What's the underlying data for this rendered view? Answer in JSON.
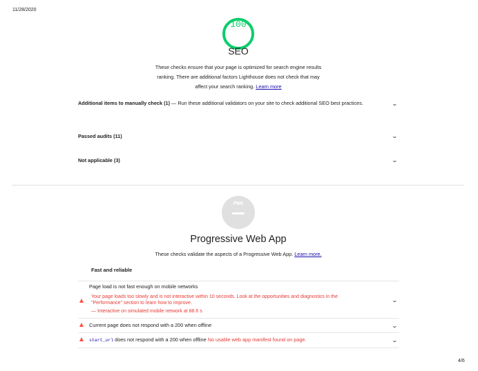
{
  "header": {
    "date": "11/28/2020"
  },
  "seo": {
    "score": "100",
    "title": "SEO",
    "description_lines": [
      "These checks ensure that your page is optimized for search engine results",
      "ranking. There are additional factors Lighthouse does not check that may",
      "affect your search ranking."
    ],
    "learn_more": "Learn more",
    "score_color": "#0cce6b",
    "groups": [
      {
        "label": "Additional items to manually check (1)",
        "detail": " — Run these additional validators on your site to check additional SEO best practices."
      },
      {
        "label": "Passed audits (11)",
        "detail": ""
      },
      {
        "label": "Not applicable (3)",
        "detail": ""
      }
    ]
  },
  "pwa": {
    "badge": "PWA",
    "title": "Progressive Web App",
    "description": "These checks validate the aspects of a Progressive Web App.",
    "learn_more": "Learn more.",
    "section": "Fast and reliable",
    "audits": [
      {
        "title": "Page load is not fast enough on mobile networks",
        "detail_lines": [
          "Your page loads too slowly and is not interactive within 10 seconds. Look at the opportunities and diagnostics in the",
          "\"Performance\" section to learn how to improve."
        ],
        "sub": "— Interactive on simulated mobile network at 88.6 s"
      },
      {
        "title": "Current page does not respond with a 200 when offline"
      },
      {
        "code": "start_url",
        "title": " does not respond with a 200 when offline",
        "error": "No usable web app manifest found on page."
      }
    ],
    "warn_color": "#ff4e42"
  },
  "footer": {
    "page": "4/6"
  }
}
